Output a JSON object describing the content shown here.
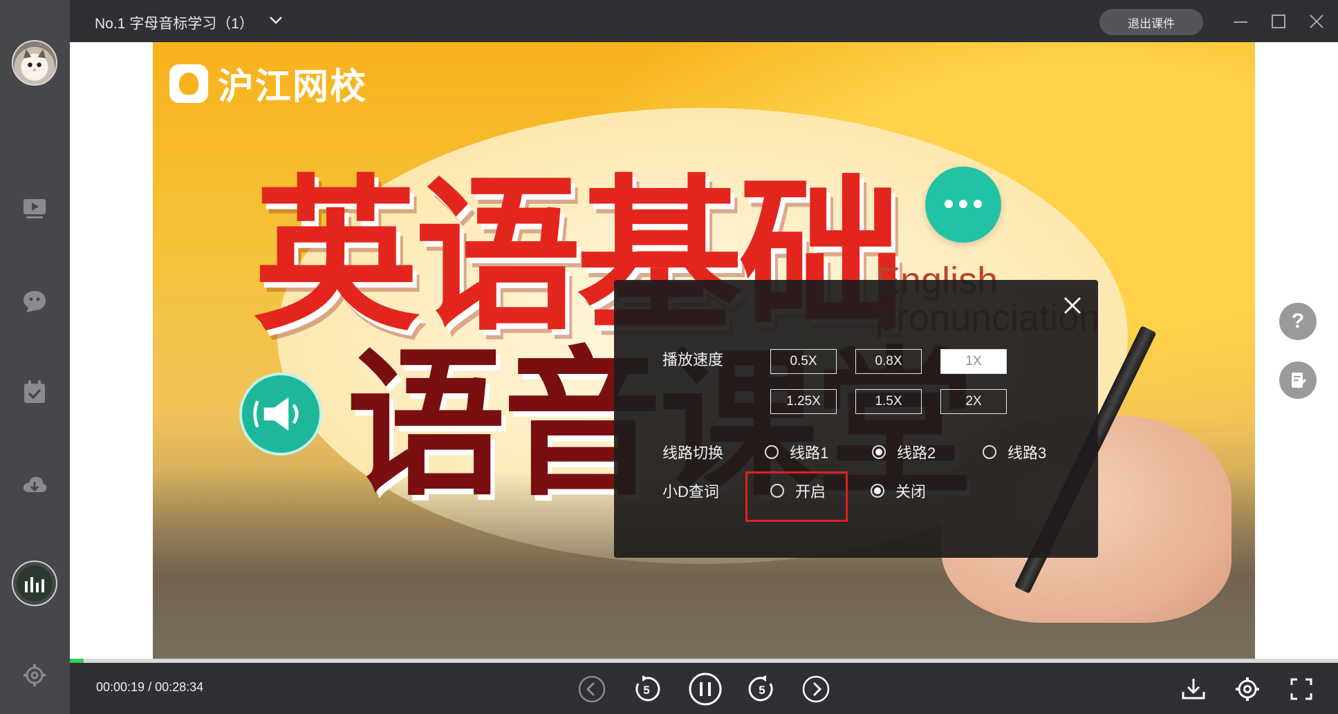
{
  "window": {
    "title": "No.1 字母音标学习（1）",
    "exit_label": "退出课件"
  },
  "sidebar": {
    "items": [
      {
        "icon": "video-icon"
      },
      {
        "icon": "chat-bubble-icon"
      },
      {
        "icon": "calendar-check-icon"
      },
      {
        "icon": "cloud-download-icon"
      },
      {
        "icon": "audio-bars-icon"
      },
      {
        "icon": "gear-icon"
      }
    ]
  },
  "slide": {
    "logo_text": "沪江网校",
    "headline_1": "英语基础",
    "headline_2": "语音课堂",
    "english_1": "English",
    "english_2": "pronunciation"
  },
  "settings_modal": {
    "speed_label": "播放速度",
    "speed_options": [
      "0.5X",
      "0.8X",
      "1X",
      "1.25X",
      "1.5X",
      "2X"
    ],
    "speed_selected": "1X",
    "line_label": "线路切换",
    "line_options": [
      "线路1",
      "线路2",
      "线路3"
    ],
    "line_selected": "线路2",
    "lookup_label": "小D查词",
    "lookup_options": [
      "开启",
      "关闭"
    ],
    "lookup_selected": "关闭"
  },
  "floating": {
    "help_glyph": "?"
  },
  "player": {
    "current_time": "00:00:19",
    "separator": "/",
    "total_time": "00:28:34",
    "progress_fraction": 0.011,
    "progress_color": "#2fce4f"
  },
  "colors": {
    "accent_green": "#2fce4f",
    "highlight_red": "#e02020",
    "slide_yellow": "#f7b21c"
  }
}
